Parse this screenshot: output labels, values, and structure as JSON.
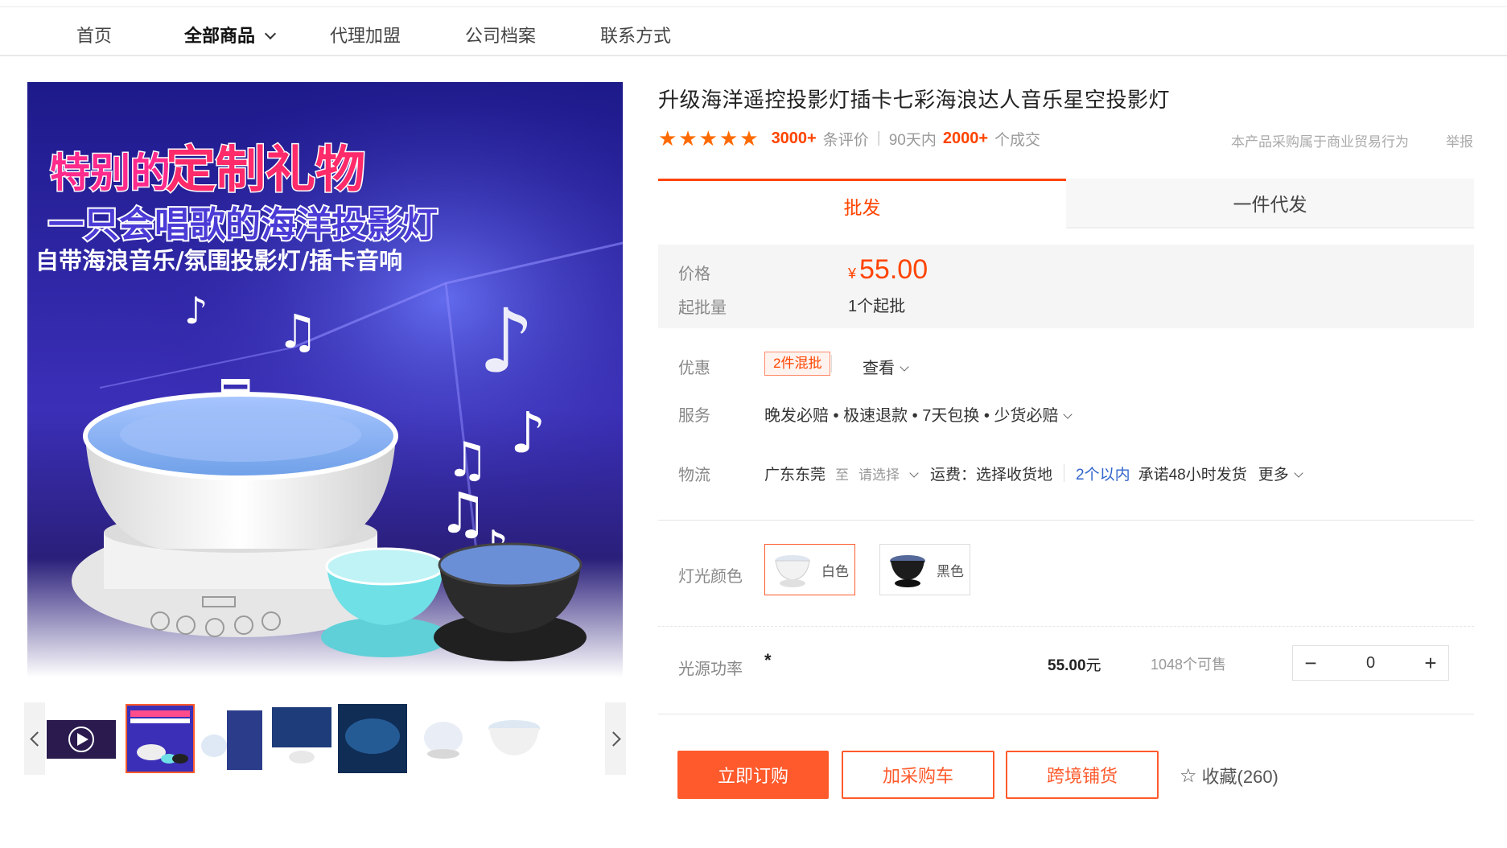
{
  "nav": {
    "items": [
      "首页",
      "全部商品",
      "代理加盟",
      "公司档案",
      "联系方式"
    ]
  },
  "main_image": {
    "headline1_a": "特别的",
    "headline1_b": "定制礼物",
    "headline2": "一只会唱歌的海洋投影灯",
    "headline3": "自带海浪音乐/氛围投影灯/插卡音响"
  },
  "product": {
    "title": "升级海洋遥控投影灯插卡七彩海浪达人音乐星空投影灯",
    "rating_stars": 5,
    "review_count": "3000+",
    "review_suffix": "条评价",
    "period": "90天内",
    "deal_count": "2000+",
    "deal_suffix": "个成交",
    "trade_note": "本产品采购属于商业贸易行为",
    "report": "举报"
  },
  "tabs": [
    "批发",
    "一件代发"
  ],
  "price_box": {
    "price_label": "价格",
    "currency": "¥",
    "price": "55.00",
    "moq_label": "起批量",
    "moq": "1个起批"
  },
  "promo": {
    "label": "优惠",
    "badge": "2件混批",
    "view": "查看"
  },
  "service": {
    "label": "服务",
    "text": "晚发必赔 • 极速退款 • 7天包换 • 少货必赔"
  },
  "logistics": {
    "label": "物流",
    "origin": "广东东莞",
    "to": "至",
    "select": "请选择",
    "shipping": "运费：选择收货地",
    "qty": "2个以内",
    "promise": "承诺48小时发货",
    "more": "更多"
  },
  "color": {
    "label": "灯光颜色",
    "options": [
      {
        "name": "白色",
        "selected": true
      },
      {
        "name": "黑色",
        "selected": false
      }
    ]
  },
  "sku": {
    "label": "光源功率",
    "value": "*",
    "price": "55.00",
    "unit": "元",
    "stock": "1048个可售",
    "qty": "0",
    "minus": "−",
    "plus": "+"
  },
  "actions": {
    "buy": "立即订购",
    "cart": "加采购车",
    "cross": "跨境铺货",
    "fav": "收藏(260)"
  },
  "colors": {
    "accent": "#ff5a2c",
    "price": "#ff4400",
    "star": "#ff6a00",
    "link": "#3366cc"
  }
}
